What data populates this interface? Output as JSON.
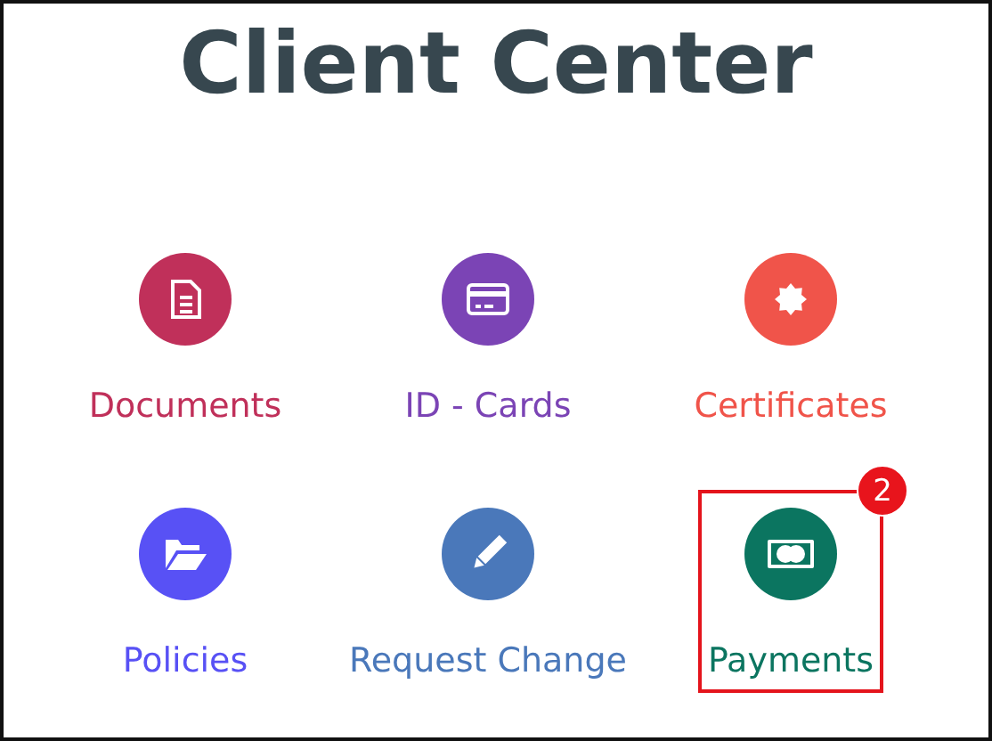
{
  "title": "Client Center",
  "tiles": [
    {
      "label": "Documents",
      "kind": "document",
      "color": "#c0305a",
      "highlighted": false
    },
    {
      "label": "ID - Cards",
      "kind": "card",
      "color": "#7b44b5",
      "highlighted": false
    },
    {
      "label": "Certificates",
      "kind": "seal",
      "color": "#f0544a",
      "highlighted": false
    },
    {
      "label": "Policies",
      "kind": "folder",
      "color": "#5851f5",
      "highlighted": false
    },
    {
      "label": "Request Change",
      "kind": "pencil",
      "color": "#4a78ba",
      "highlighted": false
    },
    {
      "label": "Payments",
      "kind": "payment",
      "color": "#0b7560",
      "highlighted": true,
      "badge": "2"
    }
  ]
}
